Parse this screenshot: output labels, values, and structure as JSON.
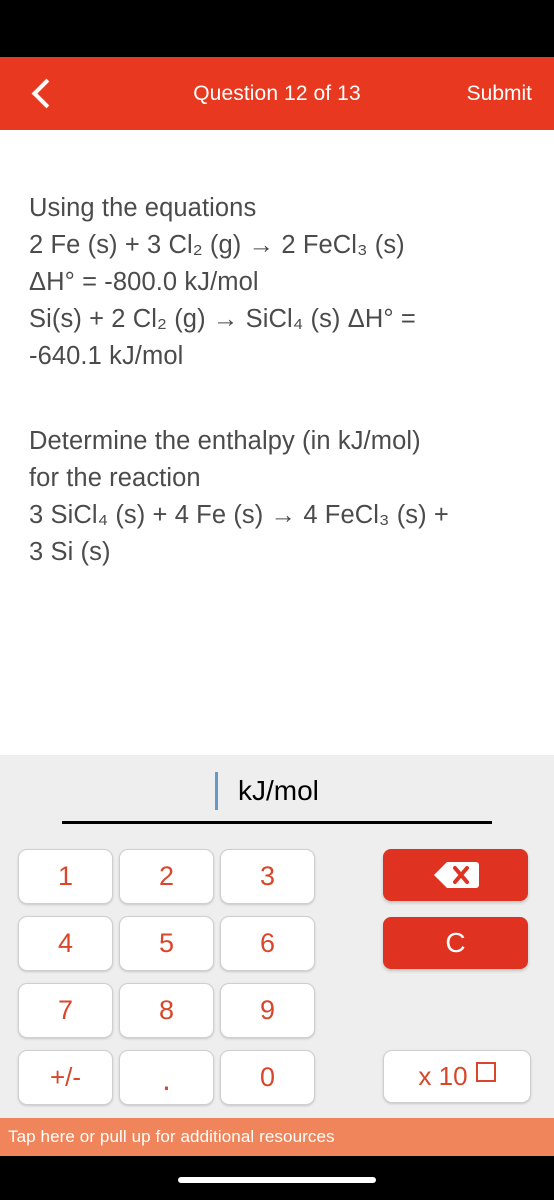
{
  "header": {
    "back_icon": "chevron-left-icon",
    "title": "Question 12 of 13",
    "submit_label": "Submit",
    "background_color": "#e8381f",
    "text_color": "#ffffff"
  },
  "question": {
    "text_color": "#4b4b4b",
    "block_1_lines": [
      "Using the equations",
      "2 Fe (s) + 3 Cl₂ (g) → 2 FeCl₃ (s)",
      "ΔH° = -800.0 kJ/mol",
      "Si(s) + 2 Cl₂ (g) → SiCl₄ (s) ΔH° =",
      "-640.1 kJ/mol"
    ],
    "block_2_lines": [
      "Determine the enthalpy (in kJ/mol)",
      "for the reaction",
      "3 SiCl₄ (s) + 4 Fe (s) → 4 FeCl₃ (s) +",
      "3 Si (s)"
    ]
  },
  "answer": {
    "value": "",
    "unit": "kJ/mol",
    "caret_color": "#6699c4"
  },
  "keypad": {
    "accent_color": "#d9472b",
    "red_key_color": "#e03220",
    "keys": [
      {
        "label": "1",
        "name": "key-1"
      },
      {
        "label": "2",
        "name": "key-2"
      },
      {
        "label": "3",
        "name": "key-3"
      },
      {
        "label": "4",
        "name": "key-4"
      },
      {
        "label": "5",
        "name": "key-5"
      },
      {
        "label": "6",
        "name": "key-6"
      },
      {
        "label": "7",
        "name": "key-7"
      },
      {
        "label": "8",
        "name": "key-8"
      },
      {
        "label": "9",
        "name": "key-9"
      },
      {
        "label": "+/-",
        "name": "key-plus-minus"
      },
      {
        "label": ".",
        "name": "key-decimal"
      },
      {
        "label": "0",
        "name": "key-0"
      }
    ],
    "backspace_icon": "backspace-icon",
    "clear_label": "C",
    "exponent_label": "x 10"
  },
  "resource_bar": {
    "label": "Tap here or pull up for additional resources",
    "background_color": "#f0845a"
  }
}
